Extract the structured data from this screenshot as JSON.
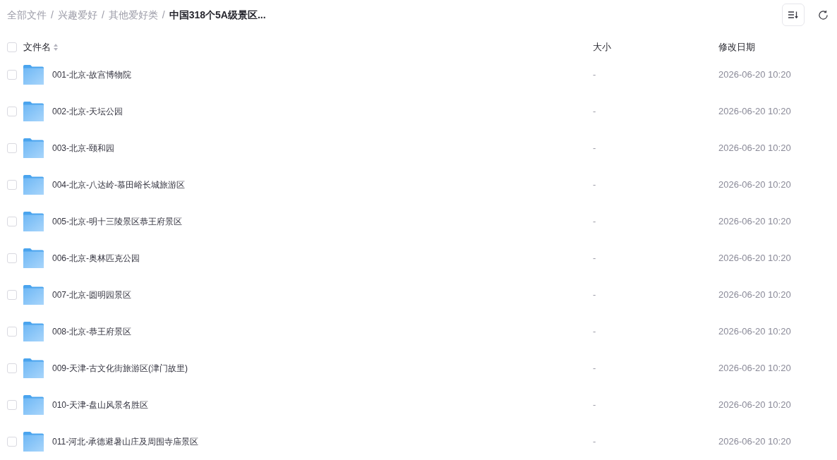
{
  "breadcrumb": [
    {
      "label": "全部文件",
      "separator": "/",
      "current": false
    },
    {
      "label": "兴趣爱好",
      "separator": "/",
      "current": false
    },
    {
      "label": "其他爱好类",
      "separator": "/",
      "current": false
    },
    {
      "label": "中国318个5A级景区...",
      "current": true
    }
  ],
  "table": {
    "select_all": {
      "checked": false
    },
    "columns": [
      {
        "label": "文件名",
        "sortable": true
      },
      {
        "label": "大小",
        "sortable": false
      },
      {
        "label": "修改日期",
        "sortable": false
      }
    ],
    "rows": [
      {
        "kind": "folder",
        "checked": false,
        "name": "001-北京-故宫博物院",
        "size": "-",
        "modified": "2026-06-20 10:20"
      },
      {
        "kind": "folder",
        "checked": false,
        "name": "002-北京-天坛公园",
        "size": "-",
        "modified": "2026-06-20 10:20"
      },
      {
        "kind": "folder",
        "checked": false,
        "name": "003-北京-颐和园",
        "size": "-",
        "modified": "2026-06-20 10:20"
      },
      {
        "kind": "folder",
        "checked": false,
        "name": "004-北京-八达岭-慕田峪长城旅游区",
        "size": "-",
        "modified": "2026-06-20 10:20"
      },
      {
        "kind": "folder",
        "checked": false,
        "name": "005-北京-明十三陵景区恭王府景区",
        "size": "-",
        "modified": "2026-06-20 10:20"
      },
      {
        "kind": "folder",
        "checked": false,
        "name": "006-北京-奥林匹克公园",
        "size": "-",
        "modified": "2026-06-20 10:20"
      },
      {
        "kind": "folder",
        "checked": false,
        "name": "007-北京-圆明园景区",
        "size": "-",
        "modified": "2026-06-20 10:20"
      },
      {
        "kind": "folder",
        "checked": false,
        "name": "008-北京-恭王府景区",
        "size": "-",
        "modified": "2026-06-20 10:20"
      },
      {
        "kind": "folder",
        "checked": false,
        "name": "009-天津-古文化街旅游区(津门故里)",
        "size": "-",
        "modified": "2026-06-20 10:20"
      },
      {
        "kind": "folder",
        "checked": false,
        "name": "010-天津-盘山风景名胜区",
        "size": "-",
        "modified": "2026-06-20 10:20"
      },
      {
        "kind": "folder",
        "checked": false,
        "name": "011-河北-承德避暑山庄及周围寺庙景区",
        "size": "-",
        "modified": "2026-06-20 10:20"
      }
    ]
  }
}
